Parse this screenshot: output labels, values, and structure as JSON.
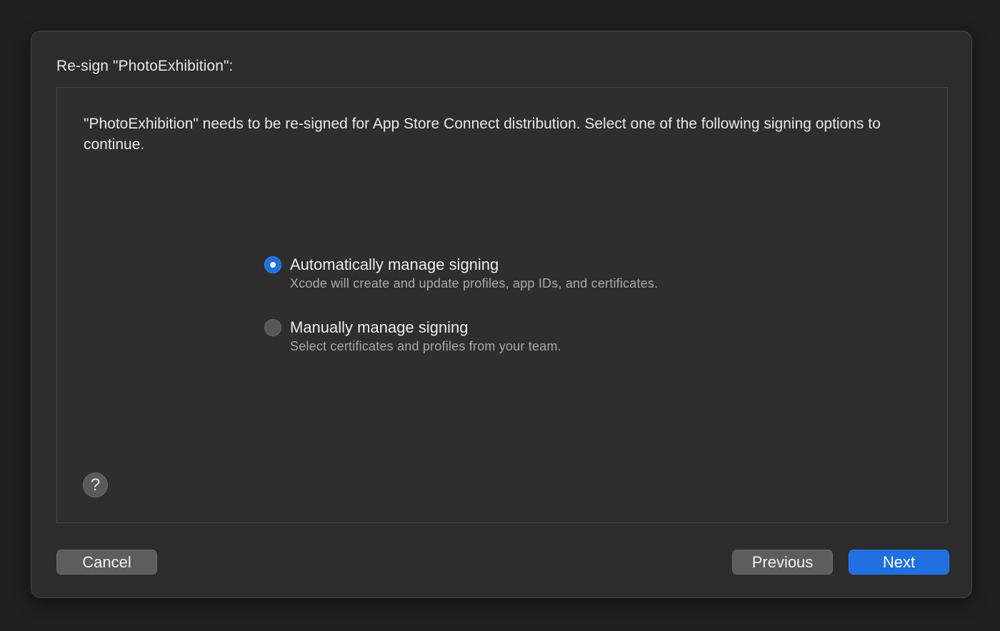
{
  "sheet": {
    "title": "Re-sign \"PhotoExhibition\":",
    "description": "\"PhotoExhibition\" needs to be re-signed for App Store Connect distribution. Select one of the following signing options to continue.",
    "options": [
      {
        "title": "Automatically manage signing",
        "subtitle": "Xcode will create and update profiles, app IDs, and certificates.",
        "selected": true
      },
      {
        "title": "Manually manage signing",
        "subtitle": "Select certificates and profiles from your team.",
        "selected": false
      }
    ],
    "help_label": "?"
  },
  "buttons": {
    "cancel": "Cancel",
    "previous": "Previous",
    "next": "Next"
  },
  "colors": {
    "accent": "#1f6fe0",
    "background": "#2c2c2c"
  }
}
